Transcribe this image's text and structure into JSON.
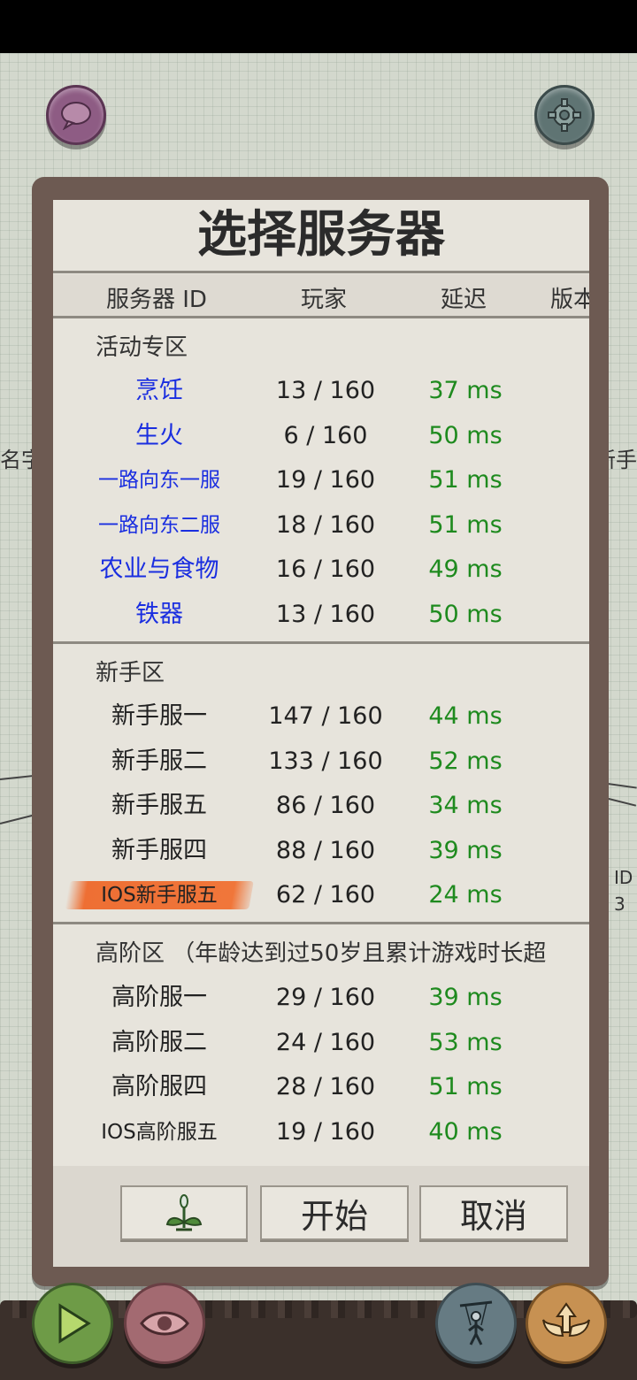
{
  "dialog": {
    "title": "选择服务器",
    "columns": [
      "服务器 ID",
      "玩家",
      "延迟",
      "版本"
    ]
  },
  "sections": [
    {
      "label": "活动专区",
      "servers": [
        {
          "name": "烹饪",
          "players": "13 / 160",
          "ping": "37 ms"
        },
        {
          "name": "生火",
          "players": "6 / 160",
          "ping": "50 ms"
        },
        {
          "name": "一路向东一服",
          "players": "19 / 160",
          "ping": "51 ms"
        },
        {
          "name": "一路向东二服",
          "players": "18 / 160",
          "ping": "51 ms"
        },
        {
          "name": "农业与食物",
          "players": "16 / 160",
          "ping": "49 ms"
        },
        {
          "name": "铁器",
          "players": "13 / 160",
          "ping": "50 ms"
        }
      ]
    },
    {
      "label": "新手区",
      "servers": [
        {
          "name": "新手服一",
          "players": "147 / 160",
          "ping": "44 ms"
        },
        {
          "name": "新手服二",
          "players": "133 / 160",
          "ping": "52 ms"
        },
        {
          "name": "新手服五",
          "players": "86 / 160",
          "ping": "34 ms"
        },
        {
          "name": "新手服四",
          "players": "88 / 160",
          "ping": "39 ms"
        },
        {
          "name": "IOS新手服五",
          "players": "62 / 160",
          "ping": "24 ms"
        }
      ]
    },
    {
      "label": "高阶区 （年龄达到过50岁且累计游戏时长超",
      "servers": [
        {
          "name": "高阶服一",
          "players": "29 / 160",
          "ping": "39 ms"
        },
        {
          "name": "高阶服二",
          "players": "24 / 160",
          "ping": "53 ms"
        },
        {
          "name": "高阶服四",
          "players": "28 / 160",
          "ping": "51 ms"
        },
        {
          "name": "IOS高阶服五",
          "players": "19 / 160",
          "ping": "40 ms"
        }
      ]
    }
  ],
  "footer": {
    "plant_icon": "sprout-icon",
    "start_label": "开始",
    "cancel_label": "取消"
  },
  "background": {
    "left_text": "名字",
    "right_text": "新手",
    "right_id_line1": "ID",
    "right_id_line2": "3"
  },
  "icons": {
    "top_left": "chat-bubble-icon",
    "top_right": "gear-icon",
    "bottom": [
      "play-icon",
      "eye-icon",
      "puppet-icon",
      "wings-arrow-icon"
    ]
  },
  "colors": {
    "event_server_name": "#1a2ee0",
    "ping": "#1e8a1e",
    "selected_highlight": "#ee6f34"
  }
}
